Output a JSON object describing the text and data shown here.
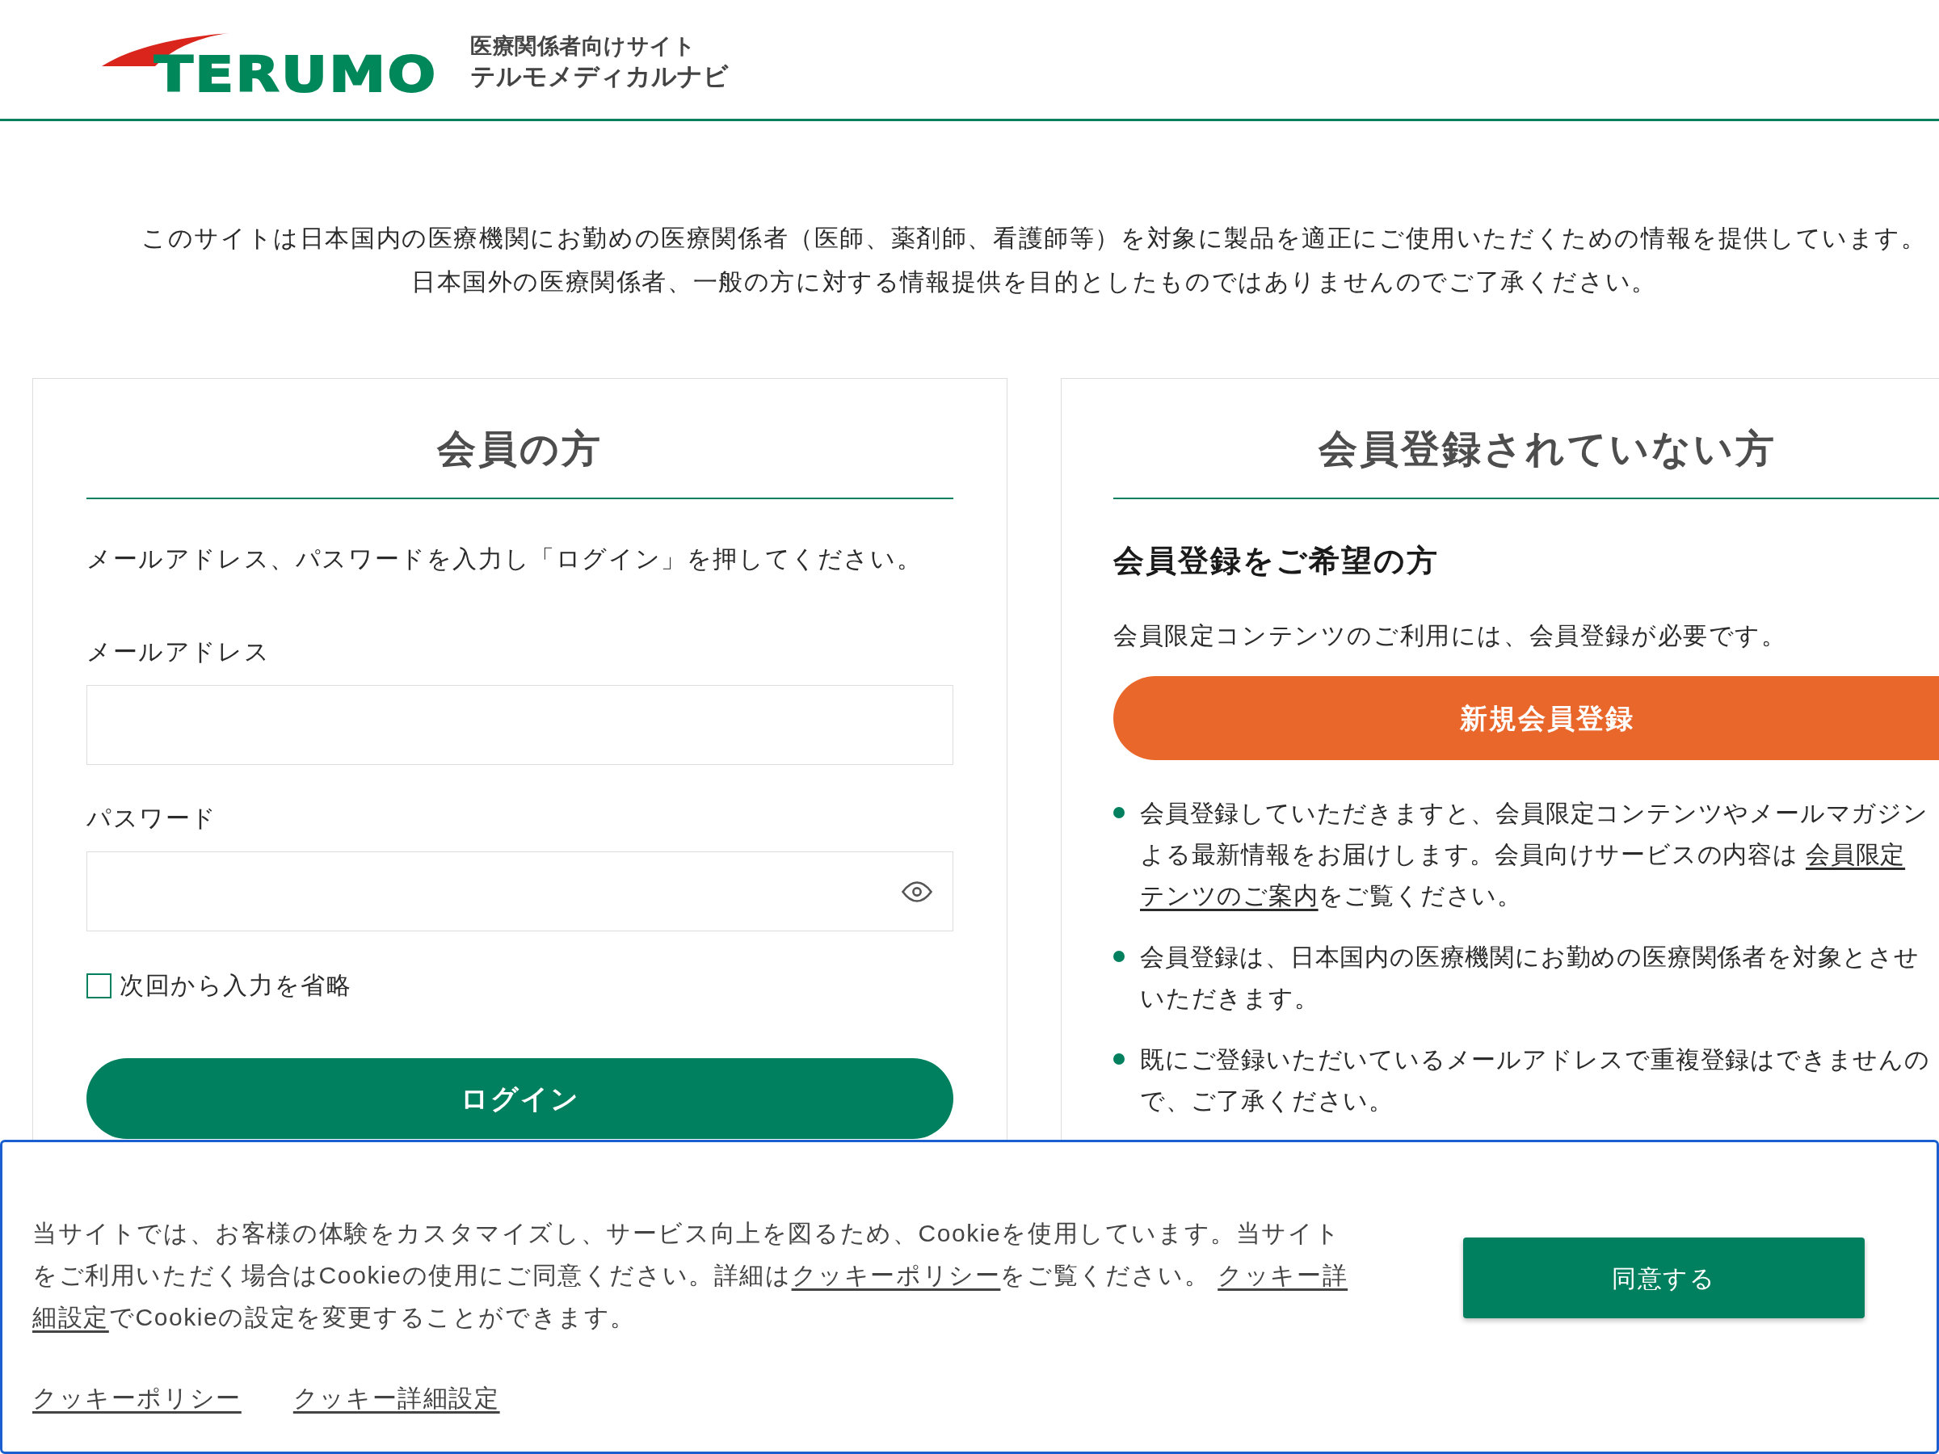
{
  "header": {
    "logo_text": "TERUMO",
    "site_tagline": "医療関係者向けサイト",
    "site_name": "テルモメディカルナビ"
  },
  "notice": [
    "このサイトは日本国内の医療機関にお勤めの医療関係者（医師、薬剤師、看護師等）を対象に製品を適正にご使用いただくための情報を提供しています。",
    "日本国外の医療関係者、一般の方に対する情報提供を目的としたものではありませんのでご了承ください。"
  ],
  "member_panel": {
    "title": "会員の方",
    "instruction": "メールアドレス、パスワードを入力し「ログイン」を押してください。",
    "fields": [
      {
        "kind": "email",
        "label": "メールアドレス"
      },
      {
        "kind": "password",
        "label": "パスワード"
      }
    ],
    "remember": {
      "label": "次回から入力を省略",
      "checked": false
    },
    "login_button": "ログイン"
  },
  "guest_panel": {
    "title": "会員登録されていない方",
    "subtitle": "会員登録をご希望の方",
    "description": "会員限定コンテンツのご利用には、会員登録が必要です。",
    "register_button": "新規会員登録",
    "bullets": [
      {
        "lines": [
          [
            {
              "kind": "text",
              "text": "会員登録していただきますと、会員限定コンテンツやメールマガジン"
            }
          ],
          [
            {
              "kind": "text",
              "text": "よる最新情報をお届けします。会員向けサービスの内容は "
            },
            {
              "kind": "link",
              "text": "会員限定"
            }
          ],
          [
            {
              "kind": "link",
              "text": "テンツのご案内"
            },
            {
              "kind": "text",
              "text": "をご覧ください。"
            }
          ]
        ]
      },
      {
        "lines": [
          [
            {
              "kind": "text",
              "text": "会員登録は、日本国内の医療機関にお勤めの医療関係者を対象とさせ"
            }
          ],
          [
            {
              "kind": "text",
              "text": "いただきます。"
            }
          ]
        ]
      },
      {
        "lines": [
          [
            {
              "kind": "text",
              "text": "既にご登録いただいているメールアドレスで重複登録はできませんの"
            }
          ],
          [
            {
              "kind": "text",
              "text": "で、ご了承ください。"
            }
          ]
        ]
      }
    ]
  },
  "cookie_banner": {
    "message_lines": [
      [
        {
          "kind": "text",
          "text": "当サイトでは、お客様の体験をカスタマイズし、サービス向上を図るため、Cookieを使用しています。当サイト"
        }
      ],
      [
        {
          "kind": "text",
          "text": "をご利用いただく場合はCookieの使用にご同意ください。詳細は"
        },
        {
          "kind": "link",
          "text": "クッキーポリシー"
        },
        {
          "kind": "text",
          "text": "をご覧ください。 "
        },
        {
          "kind": "link",
          "text": "クッキー詳"
        }
      ],
      [
        {
          "kind": "link",
          "text": "細設定"
        },
        {
          "kind": "text",
          "text": "でCookieの設定を変更することができます。"
        }
      ]
    ],
    "accept_button": "同意する",
    "links": [
      "クッキーポリシー",
      "クッキー詳細設定"
    ]
  }
}
